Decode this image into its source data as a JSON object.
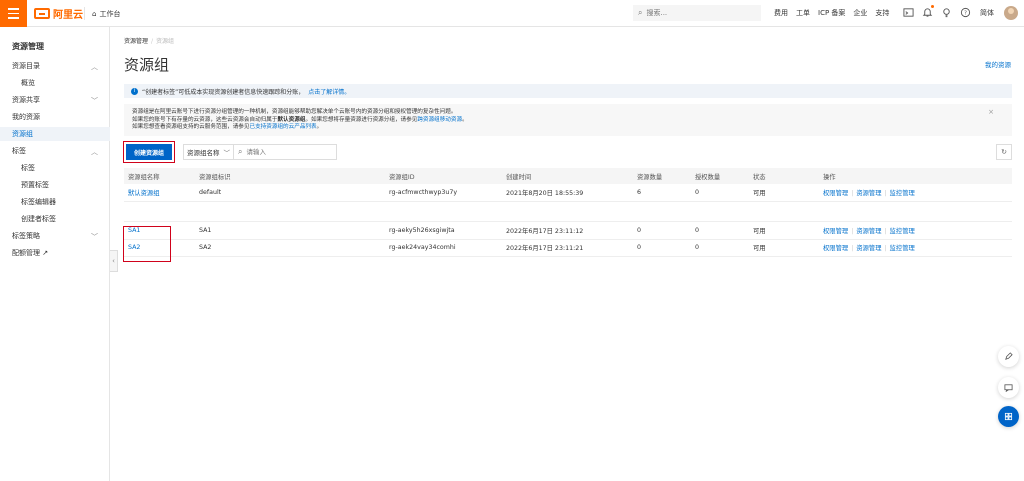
{
  "topbar": {
    "logo_text": "阿里云",
    "workbench_label": "工作台",
    "search_placeholder": "搜索...",
    "links": [
      "费用",
      "工单",
      "ICP 备案",
      "企业",
      "支持"
    ],
    "lang_label": "简体",
    "accent_color": "#ff6a00"
  },
  "sidebar": {
    "title": "资源管理",
    "items": [
      {
        "label": "资源目录",
        "expandable": true
      },
      {
        "label": "概览",
        "sub": true
      },
      {
        "label": "资源共享",
        "expandable": true
      },
      {
        "label": "我的资源"
      },
      {
        "label": "资源组",
        "active": true
      },
      {
        "label": "标签",
        "expandable": true
      },
      {
        "label": "标签",
        "sub": true
      },
      {
        "label": "预置标签",
        "sub": true
      },
      {
        "label": "标签编辑器",
        "sub": true
      },
      {
        "label": "创建者标签",
        "sub": true
      },
      {
        "label": "标签策略",
        "expandable": true
      },
      {
        "label": "配额管理 ↗"
      }
    ]
  },
  "breadcrumb": {
    "root": "资源管理",
    "current": "资源组"
  },
  "page": {
    "title": "资源组",
    "my_resources_link": "我的资源"
  },
  "info_bar": {
    "text": "“创建者标签”可低成本实现资源创建者信息快速跟踪和分账，",
    "link": "点击了解详情。"
  },
  "notice": {
    "line1": "资源组是在阿里云账号下进行资源分组管理的一种机制，资源组能够帮助您解决单个云账号内的资源分组和授权管理的复杂性问题。",
    "line2a": "如果您的账号下有存量的云资源，这些云资源会自动归属于",
    "line2b": "默认资源组",
    "line2c": "。如果您想将存量资源进行资源分组，请参见",
    "line2_link": "跨资源组移动资源",
    "line2d": "。",
    "line3a": "如果您想查看资源组支持的云服务范围，请参见",
    "line3_link": "已支持资源组的云产品列表",
    "line3b": "。"
  },
  "toolbar": {
    "create_label": "创建资源组",
    "select_value": "资源组名称",
    "filter_placeholder": "请输入"
  },
  "table": {
    "headers": [
      "资源组名称",
      "资源组标识",
      "资源组ID",
      "创建时间",
      "资源数量",
      "授权数量",
      "状态",
      "操作"
    ],
    "rows": [
      {
        "name": "默认资源组",
        "ident": "default",
        "id": "rg-acfmwcthwyp3u7y",
        "created": "2021年8月20日 18:55:39",
        "resources": "6",
        "auths": "0",
        "status": "可用"
      },
      {
        "name": "SA1",
        "ident": "SA1",
        "id": "rg-aeky5h26xsgiwjta",
        "created": "2022年6月17日 23:11:12",
        "resources": "0",
        "auths": "0",
        "status": "可用"
      },
      {
        "name": "SA2",
        "ident": "SA2",
        "id": "rg-aek24vay34comhi",
        "created": "2022年6月17日 23:11:21",
        "resources": "0",
        "auths": "0",
        "status": "可用"
      }
    ],
    "ops": [
      "权限管理",
      "资源管理",
      "监控管理"
    ]
  },
  "float_buttons": [
    "edit-icon",
    "feedback-icon",
    "apps-icon"
  ]
}
